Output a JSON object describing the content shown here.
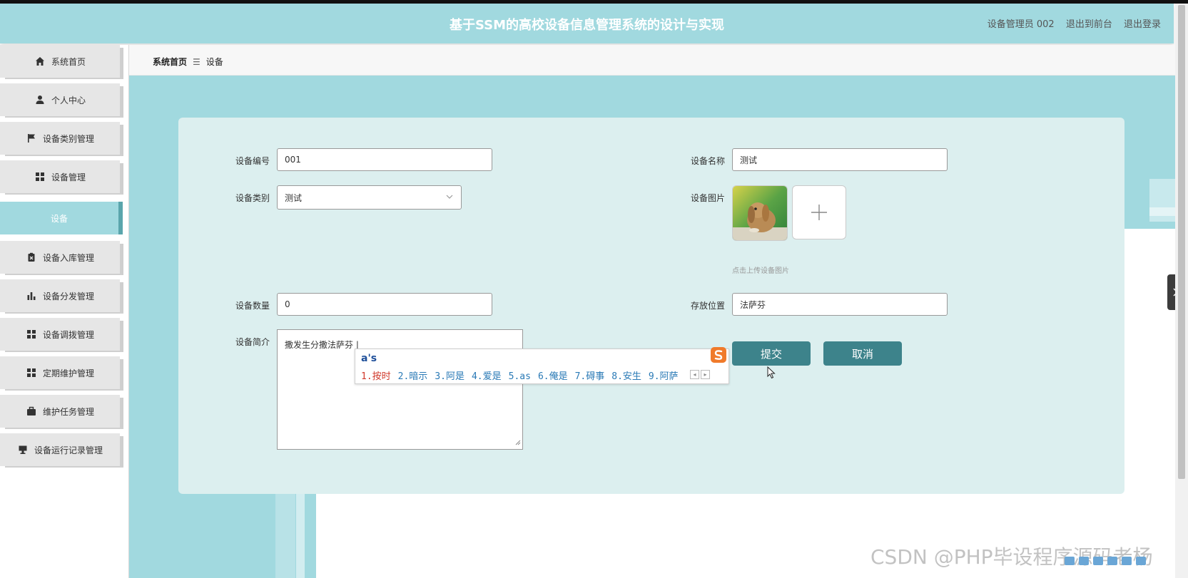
{
  "header": {
    "title": "基于SSM的高校设备信息管理系统的设计与实现",
    "user_label": "设备管理员 002",
    "back_link": "退出到前台",
    "logout_link": "退出登录"
  },
  "sidebar": {
    "items": [
      {
        "label": "系统首页",
        "icon": "home-icon"
      },
      {
        "label": "个人中心",
        "icon": "user-icon"
      },
      {
        "label": "设备类别管理",
        "icon": "flag-icon"
      },
      {
        "label": "设备管理",
        "icon": "grid-icon"
      },
      {
        "label": "设备入库管理",
        "icon": "clipboard-icon"
      },
      {
        "label": "设备分发管理",
        "icon": "bar-chart-icon"
      },
      {
        "label": "设备调拨管理",
        "icon": "grid-icon"
      },
      {
        "label": "定期维护管理",
        "icon": "grid-icon"
      },
      {
        "label": "维护任务管理",
        "icon": "briefcase-icon"
      },
      {
        "label": "设备运行记录管理",
        "icon": "display-icon"
      }
    ],
    "sub_item": "设备"
  },
  "breadcrumb": {
    "home": "系统首页",
    "separator": "☰",
    "current": "设备"
  },
  "form": {
    "device_no": {
      "label": "设备编号",
      "value": "001"
    },
    "device_name": {
      "label": "设备名称",
      "value": "测试"
    },
    "category": {
      "label": "设备类别",
      "value": "测试"
    },
    "image": {
      "label": "设备图片",
      "hint": "点击上传设备图片"
    },
    "quantity": {
      "label": "设备数量",
      "value": "0"
    },
    "location": {
      "label": "存放位置",
      "value": "法萨芬"
    },
    "intro": {
      "label": "设备简介",
      "value": "撒发生分撒法萨芬 |"
    },
    "submit": "提交",
    "cancel": "取消"
  },
  "ime": {
    "composition": "a's",
    "candidates": [
      "1.按时",
      "2.暗示",
      "3.阿是",
      "4.爱是",
      "5.as",
      "6.俺是",
      "7.碍事",
      "8.安生",
      "9.阿萨"
    ]
  },
  "watermark": "CSDN @PHP毕设程序源码老杨",
  "colors": {
    "header": "#a1d9df",
    "accent": "#3d838b",
    "card": "#dcefef"
  }
}
